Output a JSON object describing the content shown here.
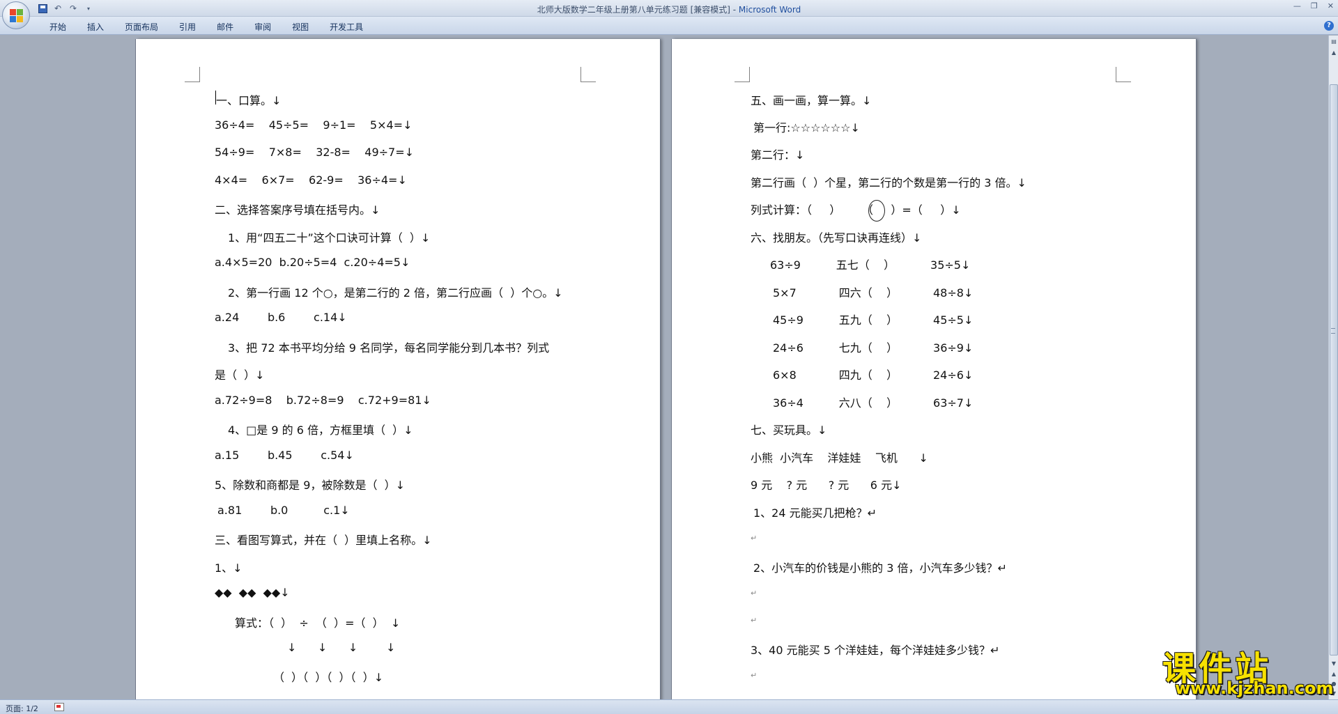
{
  "window": {
    "title": "北师大版数学二年级上册第八单元练习题 [兼容模式] - ",
    "app_name": "Microsoft Word"
  },
  "ribbon": {
    "tabs": [
      "开始",
      "插入",
      "页面布局",
      "引用",
      "邮件",
      "审阅",
      "视图",
      "开发工具"
    ]
  },
  "status": {
    "page": "页面: 1/2"
  },
  "watermark": {
    "text": "课件站",
    "url": "www.kjzhan.com"
  },
  "pages": {
    "left": [
      "一、口算。↓",
      "36÷4=    45÷5=    9÷1=    5×4=↓",
      "54÷9=    7×8=    32-8=    49÷7=↓",
      "4×4=    6×7=    62-9=    36÷4=↓",
      "二、选择答案序号填在括号内。↓",
      "1、用“四五二十”这个口诀可计算（  ）↓",
      "a.4×5=20  b.20÷5=4  c.20÷4=5↓",
      "2、第一行画 12 个○，是第二行的 2 倍，第二行应画（  ）个○。↓",
      "a.24        b.6        c.14↓",
      "3、把 72 本书平均分给 9 名同学，每名同学能分到几本书？列式",
      "是（  ）↓",
      "a.72÷9=8    b.72÷8=9    c.72+9=81↓",
      "4、□是 9 的 6 倍，方框里填（  ）↓",
      "a.15        b.45        c.54↓",
      "5、除数和商都是 9，被除数是（  ）↓",
      "a.81        b.0          c.1↓",
      "三、看图写算式，并在（  ）里填上名称。↓",
      "1、↓",
      "◆◆  ◆◆  ◆◆↓",
      "算式：（  ）  ÷  （  ）=（  ）  ↓",
      "↓      ↓      ↓        ↓",
      "（  ）（  ）（  ）（  ）↓"
    ],
    "right": [
      "五、画一画，算一算。↓",
      "第一行:☆☆☆☆☆☆↓",
      "第二行：↓",
      "第二行画（  ）个星，第二行的个数是第一行的 3 倍。↓",
      "列式计算：（     ）      （     ）=（     ）↓",
      "六、找朋友。（先写口诀再连线）↓",
      "63÷9          五七（    ）          35÷5↓",
      "5×7            四六（    ）          48÷8↓",
      "45÷9          五九（    ）          45÷5↓",
      "24÷6          七九（    ）          36÷9↓",
      "6×8            四九（    ）          24÷6↓",
      "36÷4          六八（    ）          63÷7↓",
      "七、买玩具。↓",
      "小熊  小汽车    洋娃娃    飞机      ↓",
      "9 元    ? 元      ? 元      6 元↓",
      "1、24 元能买几把枪？↵",
      "↵",
      "2、小汽车的价钱是小熊的 3 倍，小汽车多少钱？↵",
      "↵",
      "↵",
      "3、40 元能买 5 个洋娃娃，每个洋娃娃多少钱？↵",
      "↵"
    ]
  }
}
